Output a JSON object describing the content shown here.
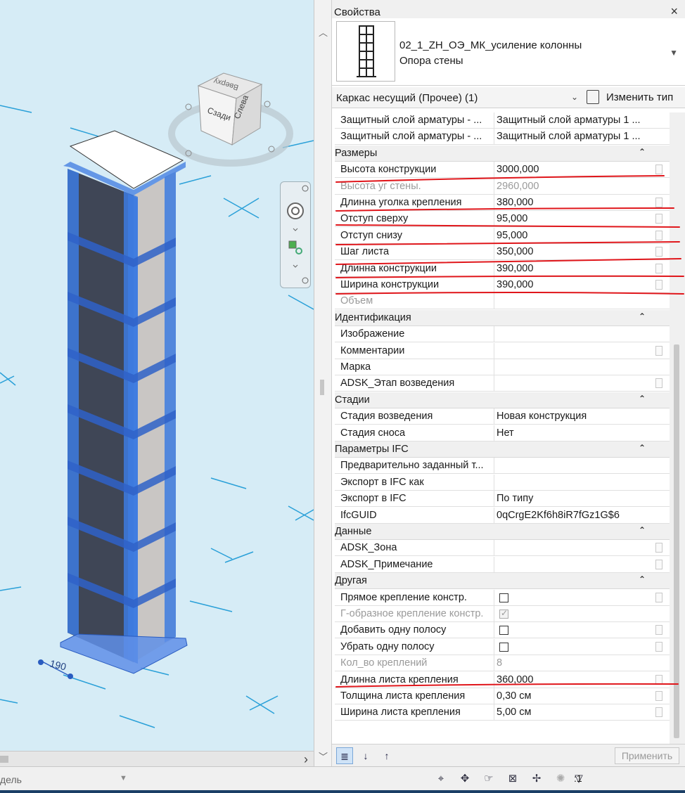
{
  "panel": {
    "title": "Свойства",
    "close": "×"
  },
  "type_selector": {
    "name": "02_1_ZH_ОЭ_МК_усиление колонны",
    "subtitle": "Опора стены",
    "dropdown_icon": "chevron-down-icon"
  },
  "filter": {
    "label": "Каркас несущий (Прочее) (1)",
    "edit_type_label": "Изменить тип"
  },
  "rows": [
    {
      "kind": "row",
      "name": "Защитный слой арматуры - ...",
      "value": "Защитный слой арматуры 1 ..."
    },
    {
      "kind": "row",
      "name": "Защитный слой арматуры - ...",
      "value": "Защитный слой арматуры 1 ..."
    },
    {
      "kind": "group",
      "name": "Размеры"
    },
    {
      "kind": "row",
      "name": "Высота конструкции",
      "value": "3000,000",
      "box": true
    },
    {
      "kind": "row",
      "name": "Высота уг стены.",
      "value": "2960,000",
      "grey": true
    },
    {
      "kind": "row",
      "name": "Длинна уголка крепления",
      "value": "380,000",
      "box": true
    },
    {
      "kind": "row",
      "name": "Отступ сверху",
      "value": "95,000",
      "box": true
    },
    {
      "kind": "row",
      "name": "Отступ снизу",
      "value": "95,000",
      "box": true
    },
    {
      "kind": "row",
      "name": "Шаг листа",
      "value": "350,000",
      "box": true
    },
    {
      "kind": "row",
      "name": "Длинна конструкции",
      "value": "390,000",
      "box": true
    },
    {
      "kind": "row",
      "name": "Ширина конструкции",
      "value": "390,000",
      "box": true
    },
    {
      "kind": "row",
      "name": "Объем",
      "value": "",
      "grey": true
    },
    {
      "kind": "group",
      "name": "Идентификация"
    },
    {
      "kind": "row",
      "name": "Изображение",
      "value": ""
    },
    {
      "kind": "row",
      "name": "Комментарии",
      "value": "",
      "box": true
    },
    {
      "kind": "row",
      "name": "Марка",
      "value": ""
    },
    {
      "kind": "row",
      "name": "ADSK_Этап возведения",
      "value": "",
      "box": true
    },
    {
      "kind": "group",
      "name": "Стадии"
    },
    {
      "kind": "row",
      "name": "Стадия возведения",
      "value": "Новая конструкция"
    },
    {
      "kind": "row",
      "name": "Стадия сноса",
      "value": "Нет"
    },
    {
      "kind": "group",
      "name": "Параметры IFC"
    },
    {
      "kind": "row",
      "name": "Предварительно заданный т...",
      "value": ""
    },
    {
      "kind": "row",
      "name": "Экспорт в IFC как",
      "value": ""
    },
    {
      "kind": "row",
      "name": "Экспорт в IFC",
      "value": "По типу"
    },
    {
      "kind": "row",
      "name": "IfcGUID",
      "value": "0qCrgE2Kf6h8iR7fGz1G$6"
    },
    {
      "kind": "group",
      "name": "Данные"
    },
    {
      "kind": "row",
      "name": "ADSK_Зона",
      "value": "",
      "box": true
    },
    {
      "kind": "row",
      "name": "ADSK_Примечание",
      "value": "",
      "box": true
    },
    {
      "kind": "group",
      "name": "Другая"
    },
    {
      "kind": "row",
      "name": "Прямое крепление констр.",
      "check": "off",
      "box": true
    },
    {
      "kind": "row",
      "name": "Г-образное крепление констр.",
      "check": "on",
      "grey": true
    },
    {
      "kind": "row",
      "name": "Добавить одну полосу",
      "check": "off",
      "box": true
    },
    {
      "kind": "row",
      "name": "Убрать одну полосу",
      "check": "off",
      "box": true
    },
    {
      "kind": "row",
      "name": "Кол_во креплений",
      "value": "8",
      "grey": true
    },
    {
      "kind": "row",
      "name": "Длинна листа крепления",
      "value": "360,000",
      "box": true
    },
    {
      "kind": "row",
      "name": "Толщина листа крепления",
      "value": "0,30 см",
      "box": true
    },
    {
      "kind": "row",
      "name": "Ширина листа крепления",
      "value": "5,00 см",
      "box": true
    }
  ],
  "footer": {
    "apply_label": "Применить"
  },
  "viewport": {
    "dimension_label": "190",
    "viewcube_back": "Сзади",
    "viewcube_left": "Слева",
    "viewcube_top": "Вверху"
  },
  "statusbar": {
    "model_label": "дель",
    "filter_count": ":1"
  },
  "colors": {
    "viewport_bg": "#d6ecf6",
    "selection_blue": "#3d7be0",
    "markup_red": "#e0161b"
  }
}
